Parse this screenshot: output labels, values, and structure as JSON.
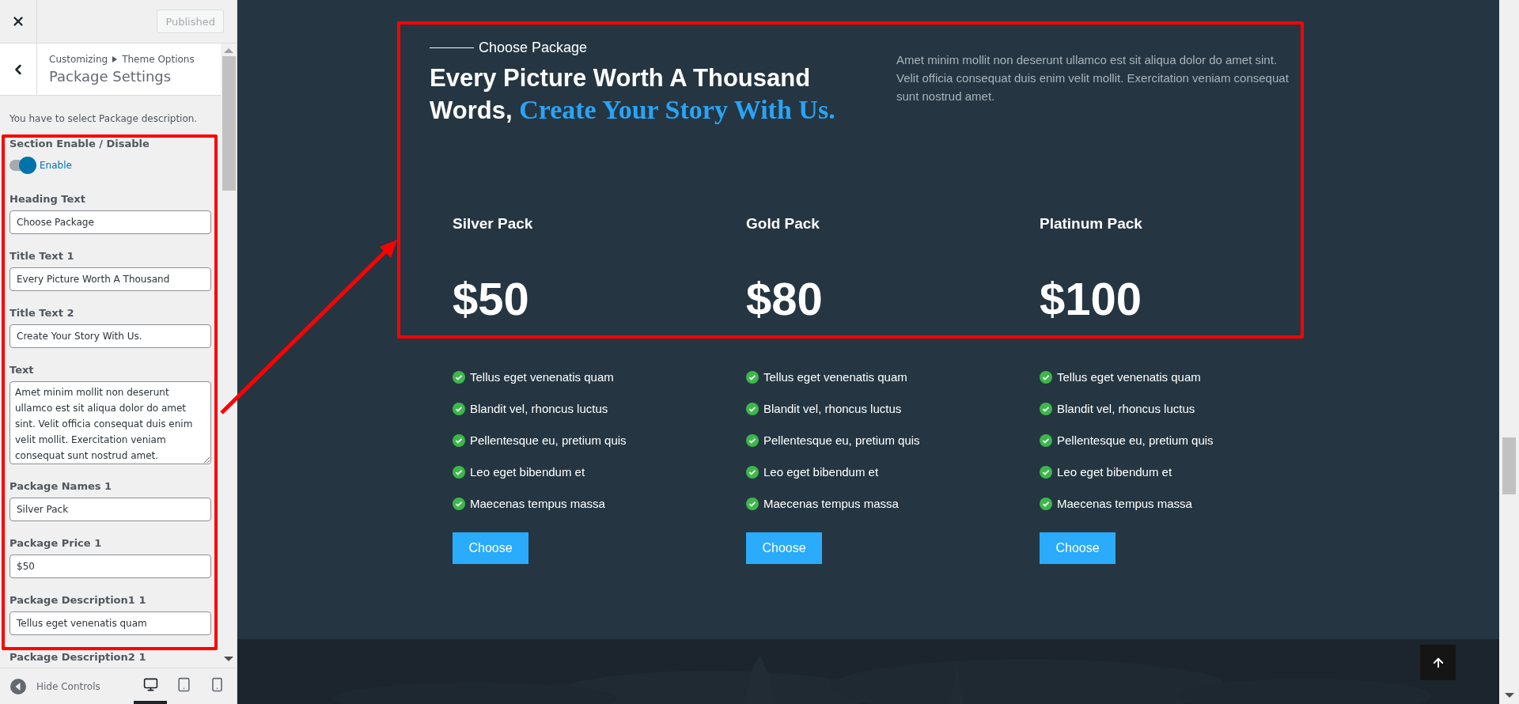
{
  "sidebar": {
    "publish_button": "Published",
    "breadcrumb": [
      "Customizing",
      "Theme Options"
    ],
    "title": "Package Settings",
    "description": "You have to select Package description.",
    "controls": [
      {
        "kind": "toggle",
        "label": "Section Enable / Disable",
        "on": true,
        "state_label": "Enable"
      },
      {
        "kind": "input",
        "label": "Heading Text",
        "value": "Choose Package"
      },
      {
        "kind": "input",
        "label": "Title Text 1",
        "value": "Every Picture Worth A Thousand"
      },
      {
        "kind": "input",
        "label": "Title Text 2",
        "value": "Create Your Story With Us."
      },
      {
        "kind": "textarea",
        "label": "Text",
        "value": "Amet minim mollit non deserunt ullamco est sit aliqua dolor do amet sint. Velit officia consequat duis enim velit mollit. Exercitation veniam consequat sunt nostrud amet."
      },
      {
        "kind": "input",
        "label": "Package Names 1",
        "value": "Silver Pack"
      },
      {
        "kind": "input",
        "label": "Package Price 1",
        "value": "$50"
      },
      {
        "kind": "input",
        "label": "Package Description1 1",
        "value": "Tellus eget venenatis quam"
      },
      {
        "kind": "label",
        "label": "Package Description2 1"
      }
    ],
    "footer": {
      "hide_controls": "Hide Controls",
      "devices": [
        {
          "kind": "desktop",
          "selected": true
        },
        {
          "kind": "tablet",
          "selected": false
        },
        {
          "kind": "mobile",
          "selected": false
        }
      ]
    }
  },
  "preview": {
    "eyebrow": "Choose Package",
    "title_plain": "Every Picture Worth A Thousand Words,",
    "title_accent": "Create Your Story With Us.",
    "intro": "Amet minim mollit non deserunt ullamco est sit aliqua dolor do amet sint. Velit officia consequat duis enim velit mollit. Exercitation veniam consequat sunt nostrud amet.",
    "packages": [
      {
        "name": "Silver Pack",
        "price": "$50",
        "features": [
          "Tellus eget venenatis quam",
          "Blandit vel, rhoncus luctus",
          "Pellentesque eu, pretium quis",
          "Leo eget bibendum et",
          "Maecenas tempus massa"
        ],
        "button": "Choose"
      },
      {
        "name": "Gold Pack",
        "price": "$80",
        "features": [
          "Tellus eget venenatis quam",
          "Blandit vel, rhoncus luctus",
          "Pellentesque eu, pretium quis",
          "Leo eget bibendum et",
          "Maecenas tempus massa"
        ],
        "button": "Choose"
      },
      {
        "name": "Platinum Pack",
        "price": "$100",
        "features": [
          "Tellus eget venenatis quam",
          "Blandit vel, rhoncus luctus",
          "Pellentesque eu, pretium quis",
          "Leo eget bibendum et",
          "Maecenas tempus massa"
        ],
        "button": "Choose"
      }
    ]
  }
}
